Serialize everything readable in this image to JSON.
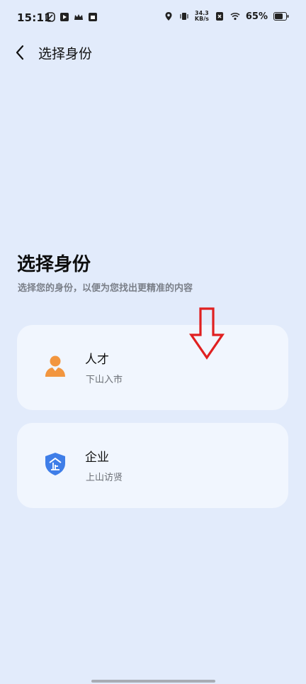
{
  "status_bar": {
    "time": "15:11",
    "net_speed_value": "34.3",
    "net_speed_unit": "KB/s",
    "battery_percent": "65%"
  },
  "header": {
    "title": "选择身份"
  },
  "main": {
    "title": "选择身份",
    "subtitle": "选择您的身份，以便为您找出更精准的内容"
  },
  "options": [
    {
      "label": "人才",
      "description": "下山入市",
      "icon": "person-icon",
      "color": "#f2963f"
    },
    {
      "label": "企业",
      "description": "上山访贤",
      "icon": "company-shield-icon",
      "color": "#3f7ee8"
    }
  ],
  "colors": {
    "background": "#e2ebfb",
    "card": "#f1f6fe",
    "annotation": "#e02020"
  }
}
